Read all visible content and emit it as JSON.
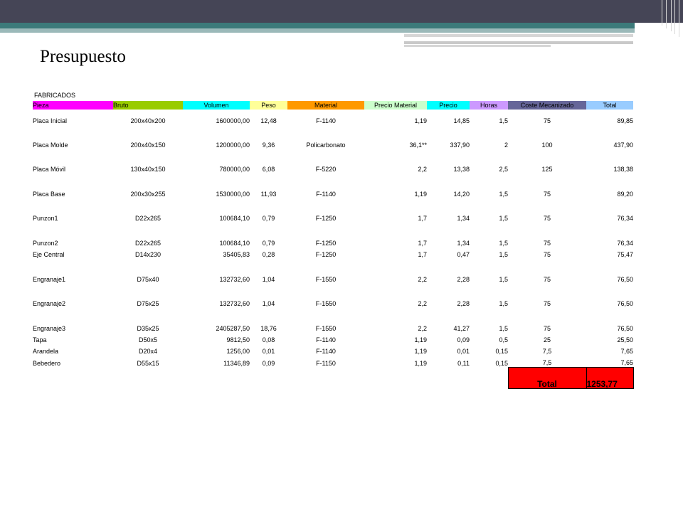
{
  "title": "Presupuesto",
  "section_label": "FABRICADOS",
  "header": [
    {
      "label": "Pieza",
      "color": "#ff00ff"
    },
    {
      "label": "Bruto",
      "color": "#99cc00"
    },
    {
      "label": "Volumen",
      "color": "#00ffff"
    },
    {
      "label": "Peso",
      "color": "#ffff99"
    },
    {
      "label": "Material",
      "color": "#ff9900"
    },
    {
      "label": "Precio Material",
      "color": "#ccffcc"
    },
    {
      "label": "Precio",
      "color": "#00ffff"
    },
    {
      "label": "Horas",
      "color": "#cc99ff"
    },
    {
      "label": "Coste Mecanizado",
      "color": "#666699"
    },
    {
      "label": "Total",
      "color": "#99ccff"
    }
  ],
  "rows": [
    [
      "Placa Inicial",
      "200x40x200",
      "1600000,00",
      "12,48",
      "F-1140",
      "1,19",
      "14,85",
      "1,5",
      "75",
      "89,85"
    ],
    [
      "Placa Molde",
      "200x40x150",
      "1200000,00",
      "9,36",
      "Policarbonato",
      "36,1**",
      "337,90",
      "2",
      "100",
      "437,90"
    ],
    [
      "Placa Móvil",
      "130x40x150",
      "780000,00",
      "6,08",
      "F-5220",
      "2,2",
      "13,38",
      "2,5",
      "125",
      "138,38"
    ],
    [
      "Placa Base",
      "200x30x255",
      "1530000,00",
      "11,93",
      "F-1140",
      "1,19",
      "14,20",
      "1,5",
      "75",
      "89,20"
    ],
    [
      "Punzon1",
      "D22x265",
      "100684,10",
      "0,79",
      "F-1250",
      "1,7",
      "1,34",
      "1,5",
      "75",
      "76,34"
    ],
    [
      "Punzon2",
      "D22x265",
      "100684,10",
      "0,79",
      "F-1250",
      "1,7",
      "1,34",
      "1,5",
      "75",
      "76,34"
    ],
    [
      "Eje Central",
      "D14x230",
      "35405,83",
      "0,28",
      "F-1250",
      "1,7",
      "0,47",
      "1,5",
      "75",
      "75,47"
    ],
    [
      "Engranaje1",
      "D75x40",
      "132732,60",
      "1,04",
      "F-1550",
      "2,2",
      "2,28",
      "1,5",
      "75",
      "76,50"
    ],
    [
      "Engranaje2",
      "D75x25",
      "132732,60",
      "1,04",
      "F-1550",
      "2,2",
      "2,28",
      "1,5",
      "75",
      "76,50"
    ],
    [
      "Engranaje3",
      "D35x25",
      "2405287,50",
      "18,76",
      "F-1550",
      "2,2",
      "41,27",
      "1,5",
      "75",
      "76,50"
    ],
    [
      "Tapa",
      "D50x5",
      "9812,50",
      "0,08",
      "F-1140",
      "1,19",
      "0,09",
      "0,5",
      "25",
      "25,50"
    ],
    [
      "Arandela",
      "D20x4",
      "1256,00",
      "0,01",
      "F-1140",
      "1,19",
      "0,01",
      "0,15",
      "7,5",
      "7,65"
    ],
    [
      "Bebedero",
      "D55x15",
      "11346,89",
      "0,09",
      "F-1150",
      "1,19",
      "0,11",
      "0,15",
      "7,5",
      "7,65"
    ]
  ],
  "total_label": "Total",
  "total_value": "1253,77",
  "colors": {
    "top_bar": "#454556",
    "accent_teal": "#3c7a7a",
    "total_cell": "#ff0000"
  }
}
